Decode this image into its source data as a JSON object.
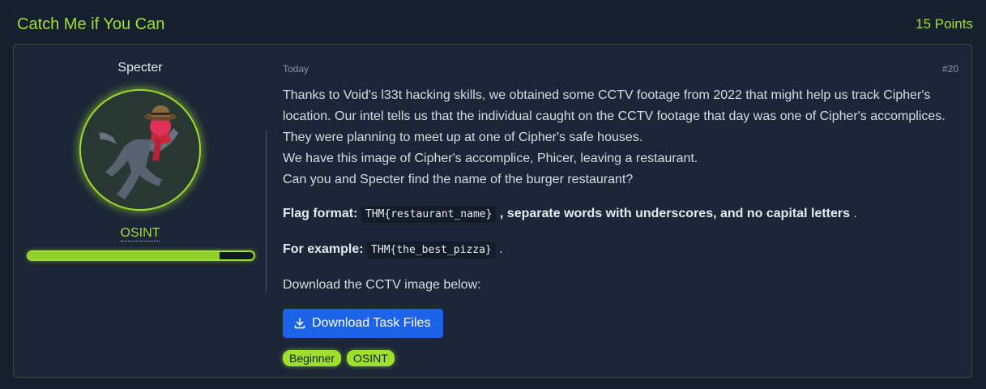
{
  "task": {
    "title": "Catch Me if You Can",
    "points": "15 Points"
  },
  "author": {
    "name": "Specter",
    "tag": "OSINT",
    "progress": 0.85
  },
  "post": {
    "date": "Today",
    "id": "#20",
    "paragraph_lines": [
      "Thanks to Void's l33t hacking skills, we obtained some CCTV footage from 2022 that might help us track Cipher's",
      "location. Our intel tells us that the individual caught on the CCTV footage that day was one of Cipher's accomplices.",
      "They were planning to meet up at one of Cipher's safe houses.",
      "We have this image of Cipher's accomplice, Phicer, leaving a restaurant.",
      "Can you and Specter find the name of the burger restaurant?"
    ],
    "flag_label": "Flag format:",
    "flag_code": "THM{restaurant_name}",
    "flag_suffix": ", separate words with underscores, and no capital letters",
    "flag_end": ".",
    "example_label": "For example:",
    "example_code": "THM{the_best_pizza}",
    "example_end": ".",
    "download_text": "Download the CCTV image below:",
    "download_button": "Download Task Files",
    "tags": [
      "Beginner",
      "OSINT"
    ]
  },
  "colors": {
    "accent": "#9fe02e",
    "button": "#1c63e8",
    "background": "#17202e",
    "card": "#1c2638"
  }
}
